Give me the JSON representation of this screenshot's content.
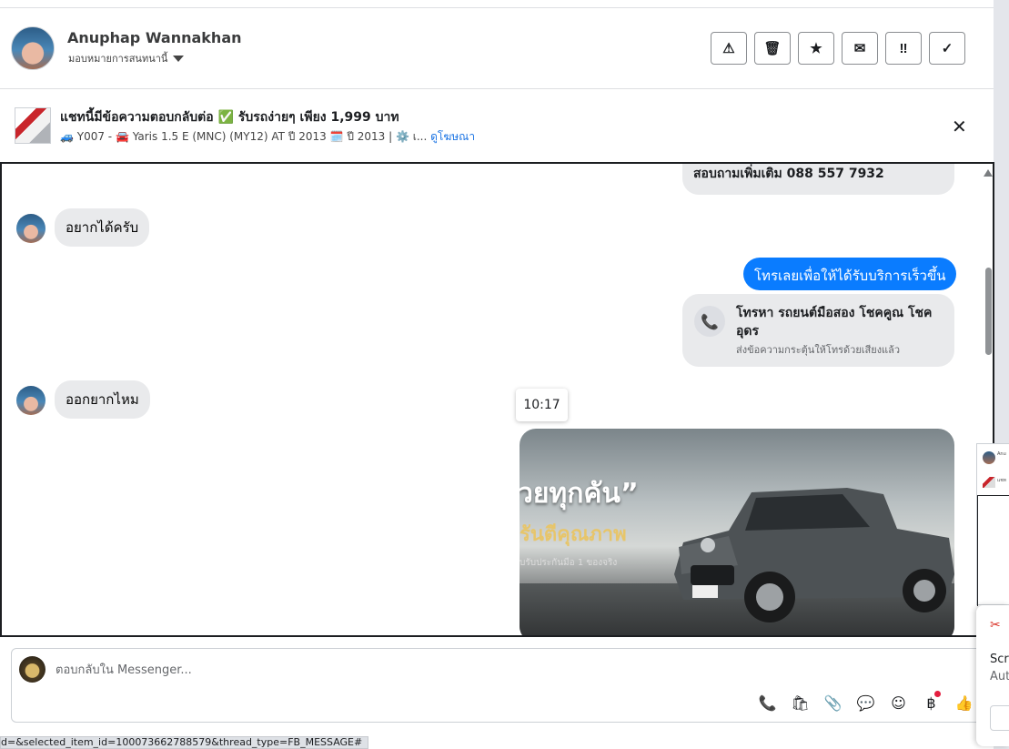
{
  "header": {
    "name": "Anuphap Wannakhan",
    "assign_label": "มอบหมายการสนทนานี้",
    "actions": [
      {
        "icon": "⚠",
        "name": "warning-icon"
      },
      {
        "icon": "🗑",
        "name": "trash-icon"
      },
      {
        "icon": "★",
        "name": "star-icon"
      },
      {
        "icon": "✉",
        "name": "mark-unread-icon"
      },
      {
        "icon": "‼",
        "name": "priority-icon"
      },
      {
        "icon": "✓",
        "name": "done-icon"
      }
    ]
  },
  "ad_bar": {
    "title": "แชทนี้มีข้อความตอบกลับต่อ ✅ รับรถง่ายๆ เพียง 1,999 บาท",
    "subtitle": "🚙 Y007 - 🚘 Yaris 1.5 E (MNC) (MY12) AT ปี 2013 🗓️ ปี 2013 | ⚙️ เ...",
    "link": "ดูโฆษณา",
    "close": "✕"
  },
  "chat": {
    "top_partial_message": "สอบถามเพิ่มเติม 088 557 7932",
    "incoming_1": "อยากได้ครับ",
    "outgoing_1": "โทรเลยเพื่อให้ได้รับบริการเร็วขึ้น",
    "call_card": {
      "title": "โทรหา รถยนต์มือสอง โชคคูณ โชค อุดร",
      "subtitle": "ส่งข้อความกระตุ้นให้โทรด้วยเสียงแล้ว"
    },
    "incoming_2": "ออกยากไหม",
    "timestamp": "10:17",
    "image": {
      "slogan": "วยทุกคัน”",
      "sub": "รันตีคุณภาพ",
      "small": "บรับประกันมือ 1 ของจริง"
    }
  },
  "composer": {
    "placeholder": "ตอบกลับใน Messenger...",
    "tools": [
      {
        "icon": "📞",
        "name": "call-add-icon"
      },
      {
        "icon": "🛍",
        "name": "shopping-bag-icon"
      },
      {
        "icon": "📎",
        "name": "attachment-icon"
      },
      {
        "icon": "💬",
        "name": "saved-replies-icon"
      },
      {
        "icon": "☺",
        "name": "emoji-icon"
      },
      {
        "icon": "฿",
        "name": "payment-icon"
      },
      {
        "icon": "👍",
        "name": "like-icon"
      }
    ]
  },
  "status_url": "d=&selected_item_id=100073662788579&thread_type=FB_MESSAGE#",
  "side_popup": {
    "text1": "Scre",
    "text2": "Aut"
  }
}
